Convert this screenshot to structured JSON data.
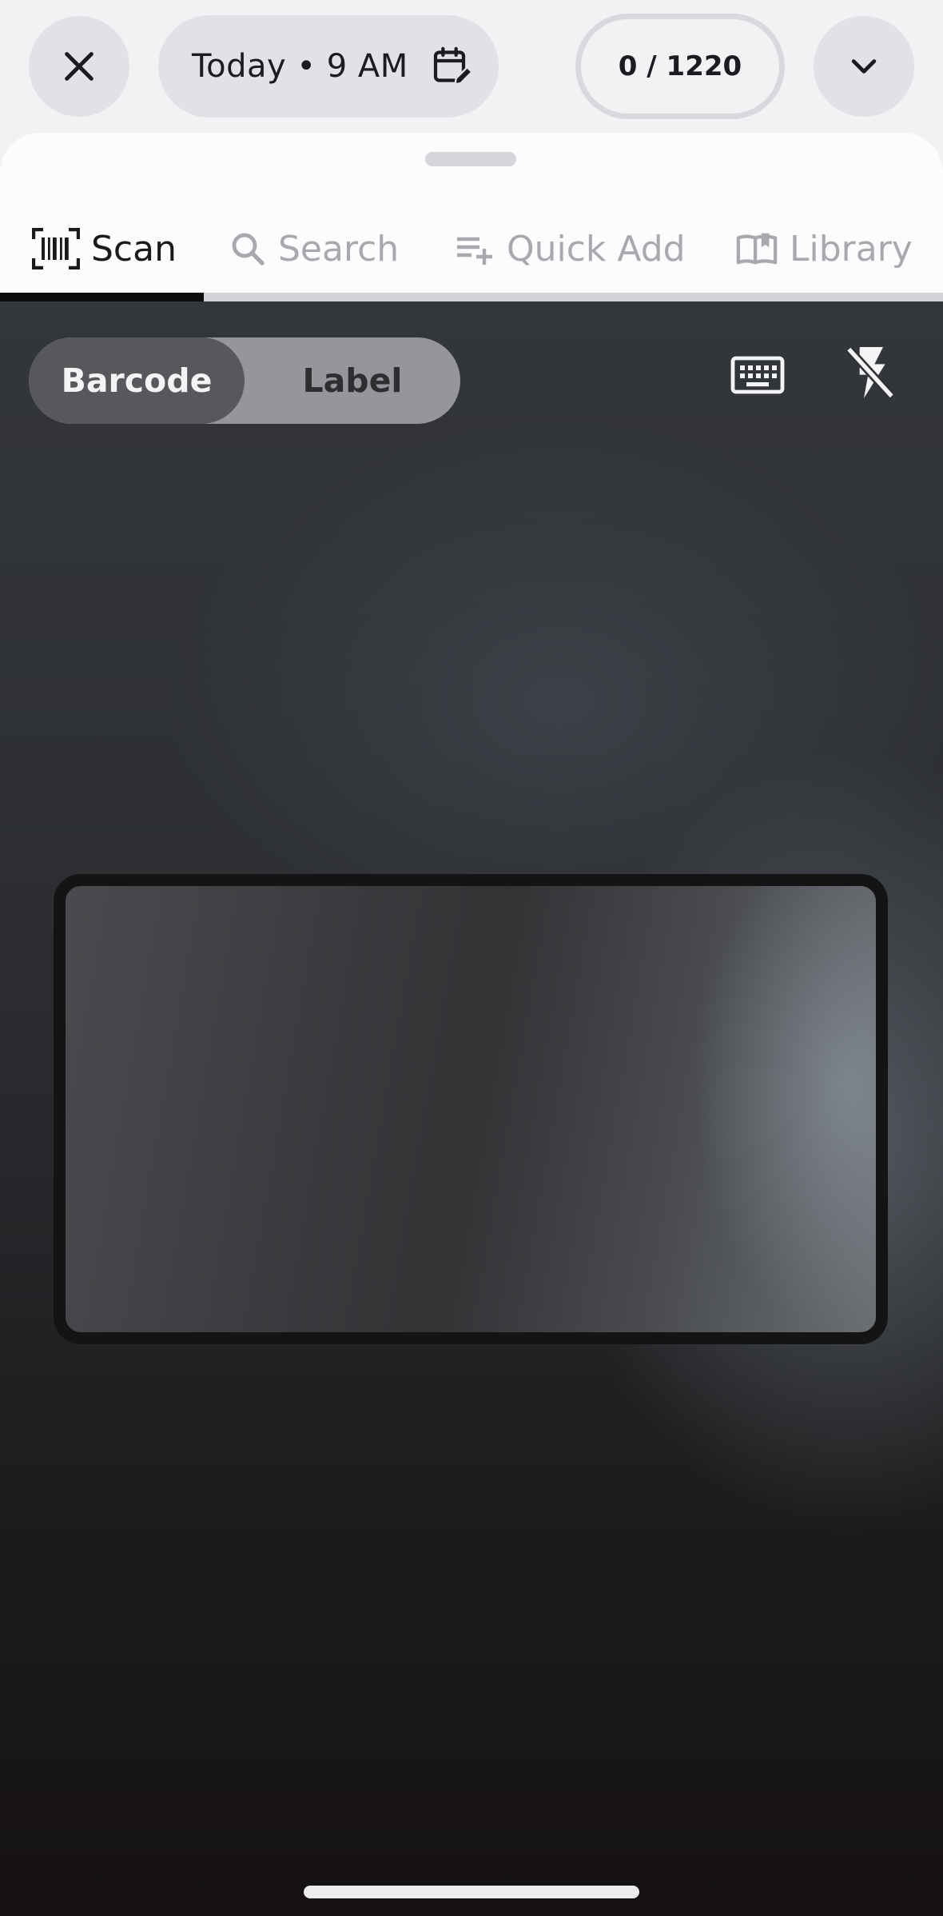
{
  "header": {
    "date_label": "Today • 9 AM",
    "count_label": "0 / 1220",
    "close_icon": "close-icon",
    "calendar_icon": "calendar-edit-icon",
    "expand_icon": "chevron-down-icon"
  },
  "tabs": [
    {
      "label": "Scan",
      "icon": "barcode-scan-icon",
      "active": true
    },
    {
      "label": "Search",
      "icon": "search-icon",
      "active": false
    },
    {
      "label": "Quick Add",
      "icon": "playlist-add-icon",
      "active": false
    },
    {
      "label": "Library",
      "icon": "book-icon",
      "active": false
    }
  ],
  "scanner": {
    "mode_options": [
      "Barcode",
      "Label"
    ],
    "selected_mode": "Barcode",
    "keyboard_icon": "keyboard-icon",
    "flash_icon": "flash-off-icon"
  },
  "colors": {
    "active_tab": "#0c0c0c",
    "inactive_tab": "#a9a8ad",
    "toggle_selected": "#58585c",
    "toggle_track": "#96969a"
  }
}
